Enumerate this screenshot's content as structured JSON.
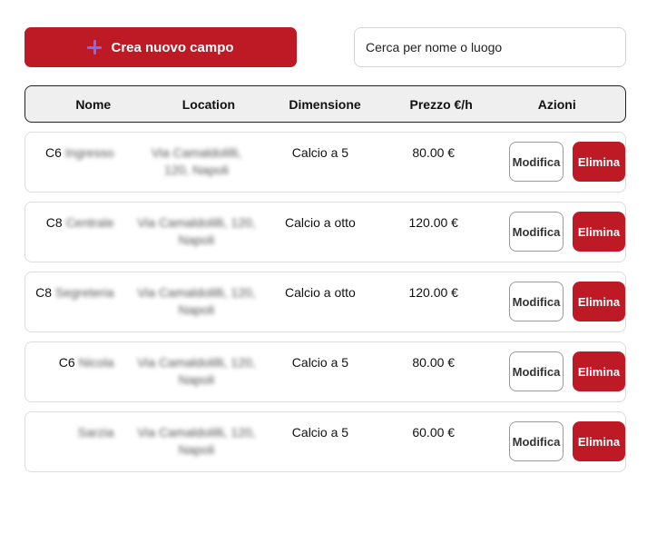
{
  "toolbar": {
    "create_label": "Crea nuovo campo",
    "search_placeholder": "Cerca per nome o luogo",
    "search_value": ""
  },
  "table": {
    "headers": [
      "Nome",
      "Location",
      "Dimensione",
      "Prezzo €/h",
      "Azioni"
    ],
    "rows": [
      {
        "name_prefix": "C6",
        "name_rest": "Ingresso",
        "location_1": "Via Camaldolilli,",
        "location_2": "120, Napoli",
        "size": "Calcio a 5",
        "price": "80.00 €"
      },
      {
        "name_prefix": "C8",
        "name_rest": "Centrale",
        "location_1": "Via Camaldolilli, 120,",
        "location_2": "Napoli",
        "size": "Calcio a otto",
        "price": "120.00 €"
      },
      {
        "name_prefix": "C8",
        "name_rest": "Segreteria",
        "location_1": "Via Camaldolilli, 120,",
        "location_2": "Napoli",
        "size": "Calcio a otto",
        "price": "120.00 €"
      },
      {
        "name_prefix": "C6",
        "name_rest": "Nicola",
        "location_1": "Via Camaldolilli, 120,",
        "location_2": "Napoli",
        "size": "Calcio a 5",
        "price": "80.00 €"
      },
      {
        "name_prefix": "",
        "name_rest": "Sarzia",
        "location_1": "Via Camaldolilli, 120,",
        "location_2": "Napoli",
        "size": "Calcio a 5",
        "price": "60.00 €"
      }
    ],
    "edit_label": "Modifica",
    "delete_label": "Elimina"
  },
  "colors": {
    "accent": "#be1a25",
    "plus_icon": "#7b6cf0",
    "header_bg": "#efefef"
  }
}
